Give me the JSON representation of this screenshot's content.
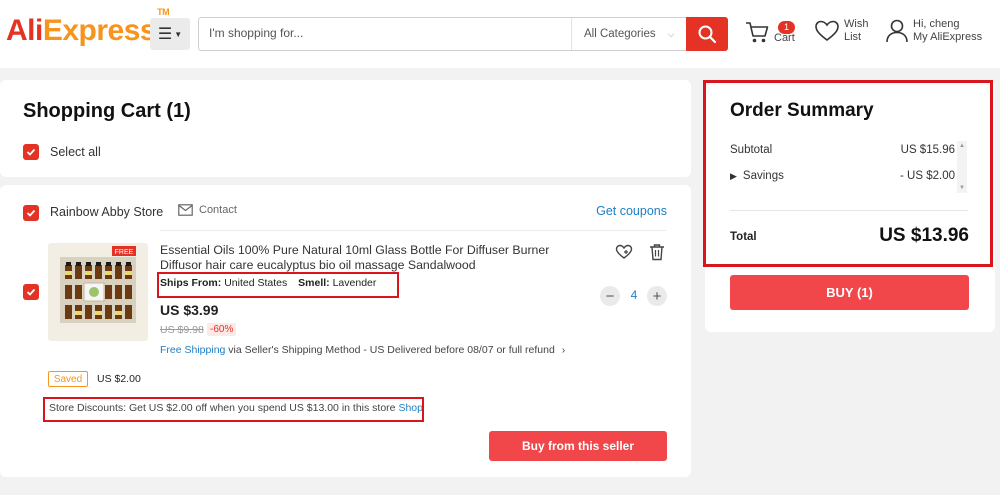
{
  "brand": {
    "part1": "Ali",
    "part2": "Express",
    "tm": "TM"
  },
  "search": {
    "placeholder": "I'm shopping for...",
    "category": "All Categories"
  },
  "header": {
    "cart_label": "Cart",
    "cart_count": "1",
    "wish_line1": "Wish",
    "wish_line2": "List",
    "account_line1": "Hi, cheng",
    "account_line2": "My AliExpress"
  },
  "cart": {
    "title": "Shopping Cart (1)",
    "select_all": "Select all"
  },
  "store": {
    "name": "Rainbow Abby Store",
    "contact": "Contact",
    "coupons": "Get coupons",
    "buy_button": "Buy from this seller",
    "saved_badge": "Saved",
    "saved_amount": "US $2.00",
    "discount_prefix": "Store Discounts:  Get US $2.00 off when you spend US $13.00 in this store",
    "discount_link": "Shop"
  },
  "product": {
    "title": "Essential Oils 100% Pure Natural 10ml Glass Bottle For Diffuser Burner Diffusor hair care eucalyptus bio oil massage Sandalwood",
    "ships_from_label": "Ships From:",
    "ships_from_value": "United States",
    "smell_label": "Smell:",
    "smell_value": "Lavender",
    "price": "US $3.99",
    "original_price": "US $9.98",
    "discount": "-60%",
    "free_shipping": "Free Shipping",
    "shipping_detail": "via Seller's Shipping Method - US  Delivered before 08/07 or full refund",
    "quantity": "4",
    "image_badge": "FREE"
  },
  "summary": {
    "title": "Order Summary",
    "subtotal_label": "Subtotal",
    "subtotal_value": "US $15.96",
    "savings_label": "Savings",
    "savings_value": "- US $2.00",
    "total_label": "Total",
    "total_value": "US $13.96",
    "buy_button": "BUY (1)"
  },
  "colors": {
    "accent": "#e43225",
    "orange": "#f7941d",
    "link": "#1e7fc5",
    "highlight": "#d9151d"
  }
}
